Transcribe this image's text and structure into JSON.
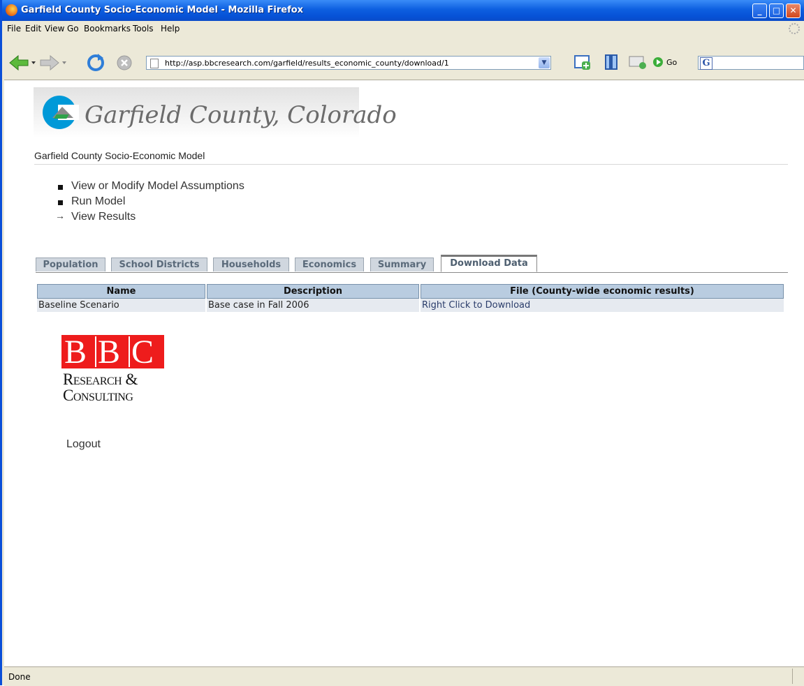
{
  "window": {
    "title": "Garfield County Socio-Economic Model - Mozilla Firefox",
    "controls": {
      "minimize": "_",
      "maximize": "□",
      "close": "✕"
    }
  },
  "menu": [
    "File",
    "Edit",
    "View",
    "Go",
    "Bookmarks",
    "Tools",
    "Help"
  ],
  "toolbar": {
    "url": "http://asp.bbcresearch.com/garfield/results_economic_county/download/1",
    "go_label": "Go",
    "search_engine_glyph": "G",
    "icons": [
      "back-icon",
      "forward-icon",
      "reload-icon",
      "stop-icon",
      "new-tab-icon",
      "bookmarks-icon",
      "mail-icon",
      "go-icon"
    ]
  },
  "banner": {
    "text": "Garfield County, Colorado"
  },
  "site_title": "Garfield County Socio-Economic Model",
  "nav": [
    {
      "label": "View or Modify Model Assumptions",
      "marker": "bullet"
    },
    {
      "label": "Run Model",
      "marker": "bullet"
    },
    {
      "label": "View Results",
      "marker": "arrow"
    }
  ],
  "nav_arrow": "→",
  "tabs": [
    {
      "label": "Population",
      "active": false
    },
    {
      "label": "School Districts",
      "active": false
    },
    {
      "label": "Households",
      "active": false
    },
    {
      "label": "Economics",
      "active": false
    },
    {
      "label": "Summary",
      "active": false
    },
    {
      "label": "Download Data",
      "active": true
    }
  ],
  "table": {
    "headers": [
      "Name",
      "Description",
      "File (County-wide economic results)"
    ],
    "rows": [
      [
        "Baseline Scenario",
        "Base case in Fall 2006",
        "Right Click to Download"
      ]
    ]
  },
  "bbc_logo": {
    "letters": [
      "B",
      "B",
      "C"
    ],
    "line1": "Research &",
    "line2": "Consulting",
    "color": "#ee1c1c"
  },
  "logout": "Logout",
  "status": "Done"
}
